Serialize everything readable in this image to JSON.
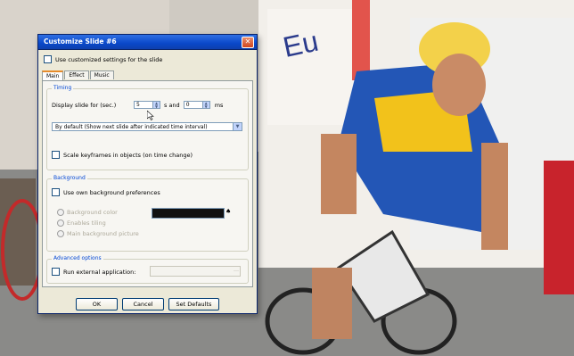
{
  "dialog": {
    "title": "Customize Slide #6",
    "use_customized": "Use customized settings for the slide",
    "tabs": [
      {
        "label": "Main"
      },
      {
        "label": "Effect"
      },
      {
        "label": "Music"
      }
    ],
    "timing": {
      "legend": "Timing",
      "display_label": "Display slide for (sec.)",
      "seconds_value": "5",
      "and_label": "s and",
      "ms_value": "0",
      "ms_label": "ms",
      "mode_value": "By default (Show next slide after indicated time interval)",
      "scale_keyframes": "Scale keyframes in objects (on time change)"
    },
    "background": {
      "legend": "Background",
      "use_own": "Use own background preferences",
      "option_color": "Background color",
      "option_tiling": "Enables tiling",
      "option_picture": "Main background picture",
      "color_value": "#111111"
    },
    "advanced": {
      "legend": "Advanced options",
      "run_external": "Run external application:"
    },
    "buttons": {
      "ok": "OK",
      "cancel": "Cancel",
      "set_defaults": "Set Defaults"
    }
  }
}
